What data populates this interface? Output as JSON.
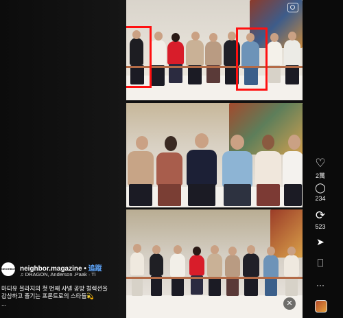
{
  "post": {
    "username": "neighbor.magazine",
    "separator": "•",
    "follow_label": "追蹤",
    "avatar_text": "NEIGHBOR",
    "music_icon": "♫",
    "music_text": "DRAGON, Anderson .Paak · Ti",
    "caption_line1": "마티유 블라지의 첫 번째 샤넬 공방 컬렉션을",
    "caption_line2": "감상하고 즐기는 프론트로의 스타들",
    "caption_emoji": "💫",
    "more_label": "..."
  },
  "actions": {
    "like_icon": "heart-icon",
    "like_count": "2萬",
    "comment_icon": "comment-icon",
    "comment_count": "234",
    "repost_icon": "repost-icon",
    "repost_count": "523",
    "share_icon": "send-icon",
    "save_icon": "bookmark-icon",
    "more_icon": "more-icon"
  },
  "video": {
    "mute_icon": "speaker-muted-icon",
    "camera_icon": "camera-icon",
    "highlight_color": "#ff1010"
  },
  "glyphs": {
    "heart": "♡",
    "comment": "◯",
    "repost": "⟳",
    "send": "➤",
    "bookmark": "⎕",
    "more": "···",
    "mute": "✕"
  }
}
